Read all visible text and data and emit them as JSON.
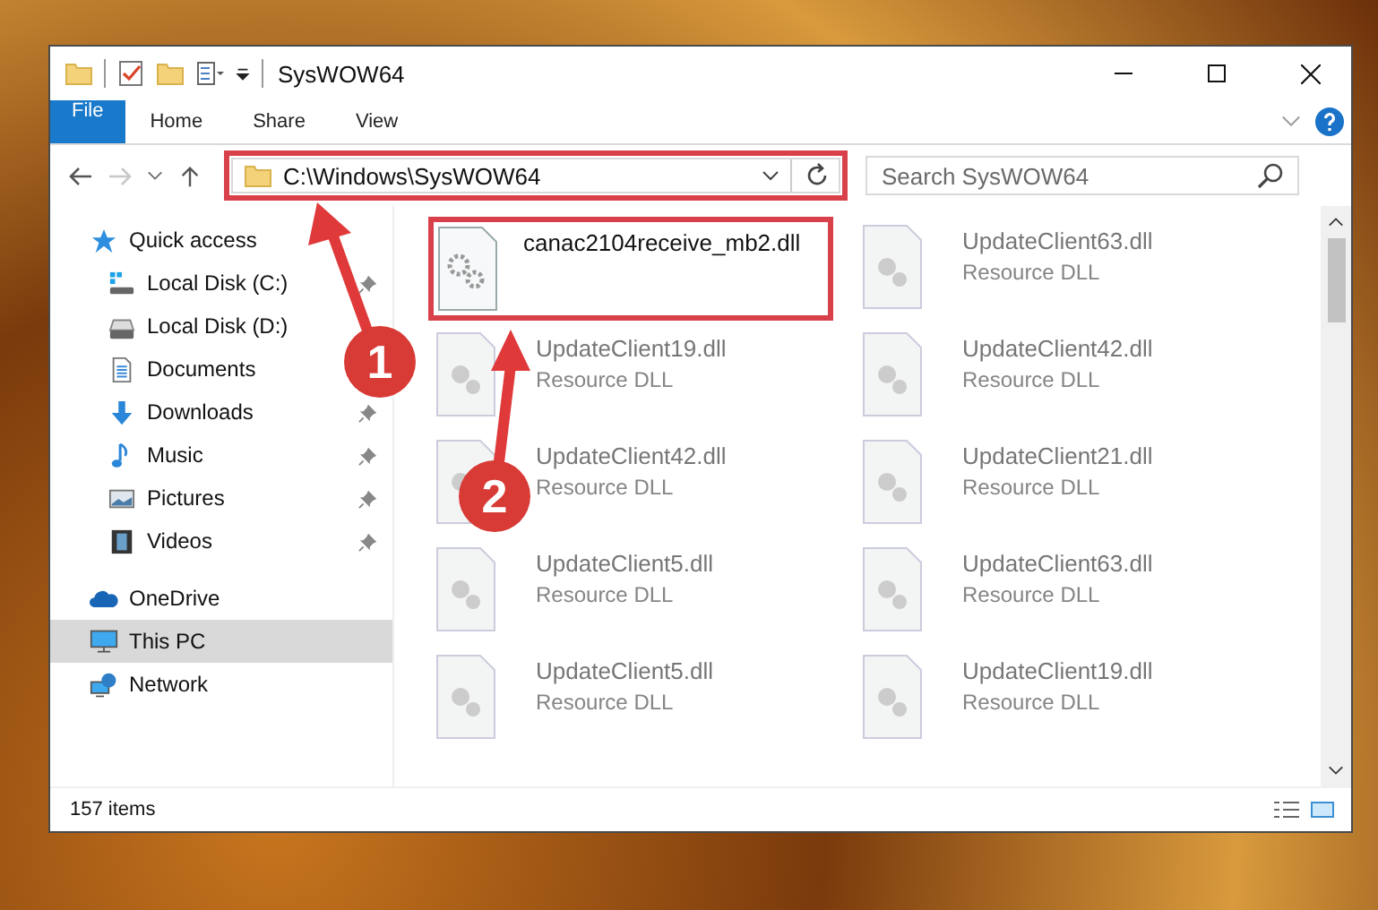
{
  "window": {
    "title": "SysWOW64"
  },
  "ribbon": {
    "tabs": [
      {
        "label": "File",
        "kind": "file"
      },
      {
        "label": "Home",
        "kind": "tab"
      },
      {
        "label": "Share",
        "kind": "tab"
      },
      {
        "label": "View",
        "kind": "tab"
      }
    ]
  },
  "address_bar": {
    "path": "C:\\Windows\\SysWOW64",
    "forward_disabled": true
  },
  "search": {
    "placeholder": "Search SysWOW64"
  },
  "sidebar": {
    "items": [
      {
        "label": "Quick access",
        "kind": "star",
        "selected": false,
        "children": [
          {
            "label": "Local Disk (C:)",
            "kind": "drive-c",
            "pinned": true
          },
          {
            "label": "Local Disk (D:)",
            "kind": "drive",
            "pinned": false
          },
          {
            "label": "Documents",
            "kind": "documents",
            "pinned": false
          },
          {
            "label": "Downloads",
            "kind": "downloads",
            "pinned": true
          },
          {
            "label": "Music",
            "kind": "music",
            "pinned": true
          },
          {
            "label": "Pictures",
            "kind": "pictures",
            "pinned": true
          },
          {
            "label": "Videos",
            "kind": "videos",
            "pinned": true
          }
        ]
      },
      {
        "label": "OneDrive",
        "kind": "cloud",
        "selected": false
      },
      {
        "label": "This PC",
        "kind": "pc",
        "selected": true
      },
      {
        "label": "Network",
        "kind": "network",
        "selected": false
      }
    ]
  },
  "files": [
    {
      "name": "canac2104receive_mb2.dll",
      "kind": "target"
    },
    {
      "name": "UpdateClient63.dll",
      "type": "Resource DLL",
      "kind": "faded"
    },
    {
      "name": "UpdateClient19.dll",
      "type": "Resource DLL",
      "kind": "faded"
    },
    {
      "name": "UpdateClient42.dll",
      "type": "Resource DLL",
      "kind": "faded"
    },
    {
      "name": "UpdateClient42.dll",
      "type": "Resource DLL",
      "kind": "faded"
    },
    {
      "name": "UpdateClient21.dll",
      "type": "Resource DLL",
      "kind": "faded"
    },
    {
      "name": "UpdateClient5.dll",
      "type": "Resource DLL",
      "kind": "faded"
    },
    {
      "name": "UpdateClient63.dll",
      "type": "Resource DLL",
      "kind": "faded"
    },
    {
      "name": "UpdateClient5.dll",
      "type": "Resource DLL",
      "kind": "faded"
    },
    {
      "name": "UpdateClient19.dll",
      "type": "Resource DLL",
      "kind": "faded"
    }
  ],
  "status_bar": {
    "count": "157 items"
  },
  "callouts": [
    {
      "number": "1"
    },
    {
      "number": "2"
    }
  ]
}
